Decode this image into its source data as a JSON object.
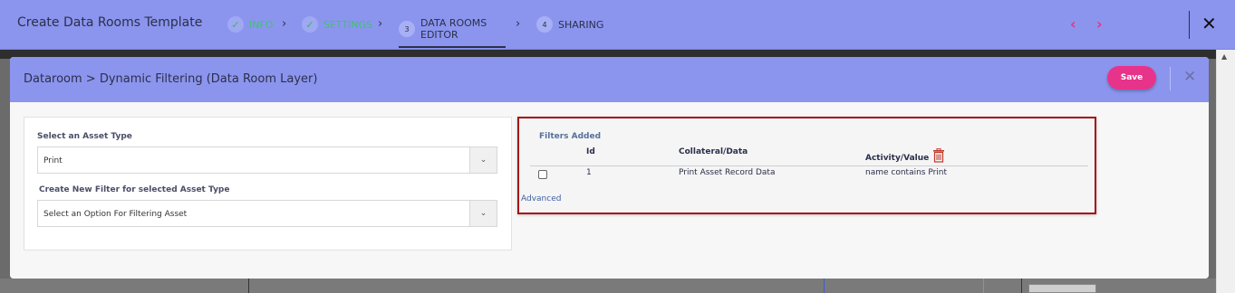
{
  "app": {
    "title": "Create Data Rooms Template"
  },
  "wizard": {
    "steps": [
      {
        "num": "",
        "label": "INFO",
        "state": "done"
      },
      {
        "num": "",
        "label": "SETTINGS",
        "state": "done"
      },
      {
        "num": "3",
        "label_line1": "DATA ROOMS",
        "label_line2": "EDITOR",
        "state": "active"
      },
      {
        "num": "4",
        "label": "SHARING",
        "state": "pending"
      }
    ],
    "prev_icon": "chevron-left-icon",
    "next_icon": "chevron-right-icon",
    "close_icon": "close-icon"
  },
  "modal": {
    "title": "Dataroom > Dynamic Filtering (Data Room Layer)",
    "save_label": "Save",
    "close_icon": "close-icon"
  },
  "asset_form": {
    "asset_type_label": "Select an Asset Type",
    "asset_type_value": "Print",
    "new_filter_label": "Create New Filter for selected Asset Type",
    "new_filter_placeholder": "Select an Option For Filtering Asset"
  },
  "filters": {
    "title": "Filters Added",
    "columns": {
      "id": "Id",
      "collateral": "Collateral/Data",
      "activity": "Activity/Value"
    },
    "rows": [
      {
        "id": "1",
        "collateral": "Print Asset Record Data",
        "activity": "name contains Print",
        "checked": false
      }
    ],
    "advanced_label": "Advanced",
    "delete_icon": "trash-icon"
  },
  "colors": {
    "header_bg": "#8b95ee",
    "accent": "#e8338a",
    "done_green": "#3cc56a",
    "highlight_border": "#a30f12"
  }
}
